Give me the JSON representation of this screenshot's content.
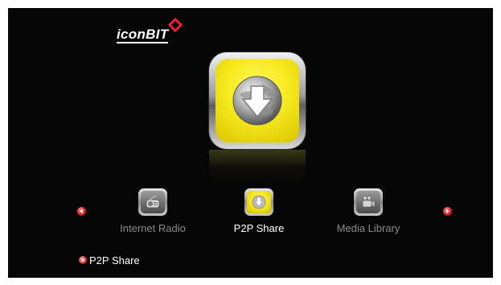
{
  "brand": {
    "logo_text": "iconBIT"
  },
  "hero": {
    "icon": "download-globe-icon"
  },
  "menu": {
    "items": [
      {
        "label": "Internet Radio",
        "icon": "radio-icon",
        "selected": false
      },
      {
        "label": "P2P Share",
        "icon": "download-globe-icon",
        "selected": true
      },
      {
        "label": "Media Library",
        "icon": "film-camera-icon",
        "selected": false
      }
    ],
    "prev_arrow": "arrow-left-icon",
    "next_arrow": "arrow-right-icon"
  },
  "status": {
    "label": "P2P Share",
    "icon": "bullet-icon"
  },
  "colors": {
    "accent_yellow": "#f7ea1e",
    "arrow_red": "#d62222",
    "background": "#060606",
    "inactive_text": "#8a8a8a",
    "active_text": "#ffffff"
  }
}
